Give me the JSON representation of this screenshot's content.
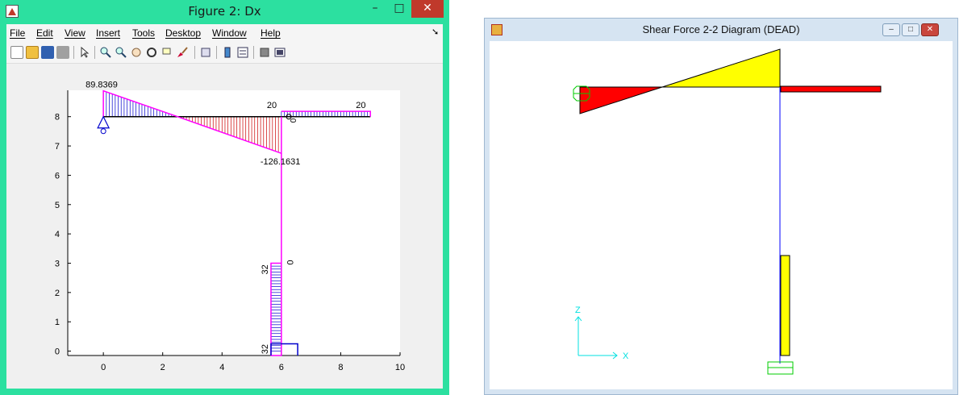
{
  "figure_window": {
    "title": "Figure 2: Dx",
    "menu": [
      "File",
      "Edit",
      "View",
      "Insert",
      "Tools",
      "Desktop",
      "Window",
      "Help"
    ],
    "menu_arrow": "➘",
    "controls": {
      "minimize": "–",
      "maximize": "□",
      "close": "✕"
    },
    "toolbar_icons": [
      "new-figure-icon",
      "open-file-icon",
      "save-icon",
      "print-icon",
      "pointer-icon",
      "zoom-in-icon",
      "zoom-out-icon",
      "pan-icon",
      "rotate-icon",
      "data-cursor-icon",
      "brush-icon",
      "link-icon",
      "colorbar-icon",
      "legend-icon",
      "hide-plot-tools-icon",
      "show-plot-tools-icon"
    ],
    "plot": {
      "x_ticks": [
        "0",
        "2",
        "4",
        "6",
        "8",
        "10"
      ],
      "y_ticks": [
        "0",
        "1",
        "2",
        "3",
        "4",
        "5",
        "6",
        "7",
        "8"
      ],
      "labels": {
        "max": "89.8369",
        "min": "-126.1631",
        "right_start": "20",
        "right_end": "20",
        "right_zero": "0",
        "col_top": "32",
        "col_zero": "0",
        "col_bottom": "32"
      }
    }
  },
  "sap_window": {
    "title": "Shear Force 2-2 Diagram   (DEAD)",
    "controls": {
      "minimize": "–",
      "maximize": "□",
      "close": "✕"
    },
    "axis_labels": {
      "z": "Z",
      "x": "X"
    }
  },
  "colors": {
    "figure_bg": "#2ce0a0",
    "diagram_line": "#ff00ff",
    "positive_hatch": "#0000cc",
    "negative_hatch": "#cc0000",
    "frame_member": "#000000",
    "sap_positive": "#ffff00",
    "sap_negative": "#ff0000",
    "sap_column": "#0000ff",
    "support": "#00cc00",
    "axis_gizmo": "#00ffff"
  }
}
